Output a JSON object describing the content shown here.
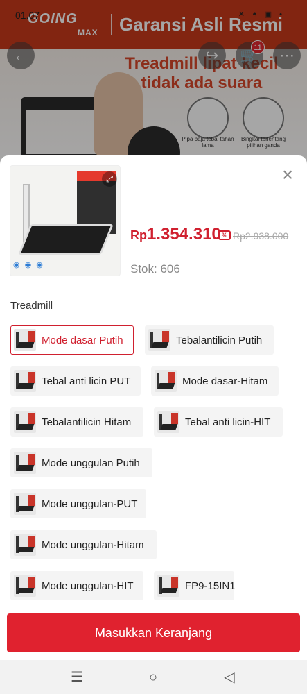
{
  "status_bar": {
    "time": "01.07",
    "icons": "✕ ◓ ▣ •"
  },
  "banner": {
    "brand": "GOING",
    "brand_sub": "MAX",
    "title": "Garansi Asli Resmi",
    "headline": "Treadmill lipat kecil tidak ada suara",
    "feature_1": "Pipa baja tebal tahan lama",
    "feature_2": "Bingkai terlentang pilihan ganda"
  },
  "top_actions": {
    "back_icon": "back-arrow-icon",
    "share_icon": "share-icon",
    "cart_icon": "cart-icon",
    "cart_count": "11",
    "more_icon": "more-icon"
  },
  "product": {
    "currency": "Rp",
    "price": "1.354.310",
    "old_price": "Rp2.938.000",
    "stock": "Stok: 606",
    "thumb_badges": "◉ ◉ ◉"
  },
  "variation": {
    "label": "Treadmill",
    "options": [
      {
        "label": "Mode dasar Putih",
        "selected": true
      },
      {
        "label": "Tebalantilicin Putih",
        "selected": false
      },
      {
        "label": "Tebal anti licin PUT",
        "selected": false
      },
      {
        "label": "Mode dasar-Hitam",
        "selected": false
      },
      {
        "label": "Tebalantilicin Hitam",
        "selected": false
      },
      {
        "label": "Tebal anti licin-HIT",
        "selected": false
      },
      {
        "label": "Mode unggulan Putih",
        "selected": false
      },
      {
        "label": "Mode unggulan-PUT",
        "selected": false
      },
      {
        "label": "Mode unggulan-Hitam",
        "selected": false
      },
      {
        "label": "Mode unggulan-HIT",
        "selected": false
      },
      {
        "label": "FP9-15IN1",
        "selected": false
      }
    ]
  },
  "cta": {
    "label": "Masukkan Keranjang"
  },
  "colors": {
    "accent": "#e0222f",
    "price": "#d0202f"
  }
}
